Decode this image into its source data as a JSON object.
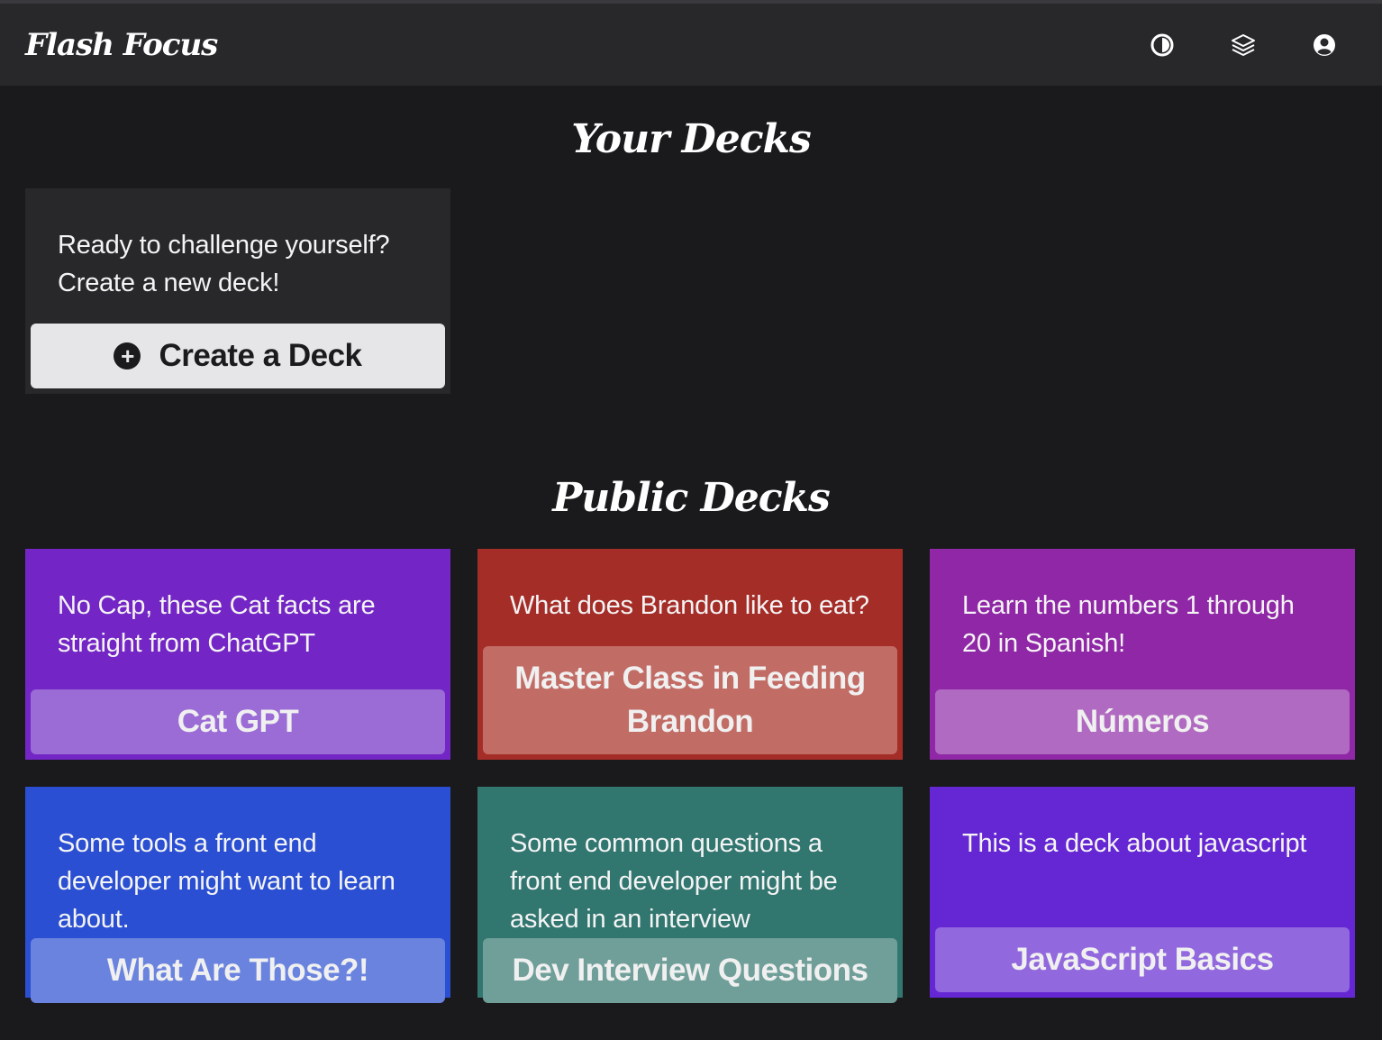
{
  "header": {
    "brand": "Flash Focus",
    "icons": [
      "theme-toggle-icon",
      "decks-stack-icon",
      "account-icon"
    ]
  },
  "your_decks": {
    "title": "Your Decks",
    "create_card": {
      "description": "Ready to challenge yourself? Create a new deck!",
      "button_label": "Create a Deck",
      "button_icon": "plus-circle-icon"
    }
  },
  "public_decks": {
    "title": "Public Decks",
    "decks": [
      {
        "description": "No Cap, these Cat facts are straight from ChatGPT",
        "title": "Cat GPT",
        "color": "#7325c5",
        "button_color": "#9b6bd6"
      },
      {
        "description": "What does Brandon like to eat?",
        "title": "Master Class in Feeding Brandon",
        "color": "#a52d28",
        "button_color": "#c26c66"
      },
      {
        "description": "Learn the numbers 1 through 20 in Spanish!",
        "title": "Números",
        "color": "#8f27a6",
        "button_color": "#b16ac1"
      },
      {
        "description": "Some tools a front end developer might want to learn about.",
        "title": "What Are Those?!",
        "color": "#2a4fd2",
        "button_color": "#6a83df"
      },
      {
        "description": "Some common questions a front end developer might be asked in an interview",
        "title": "Dev Interview Questions",
        "color": "#327670",
        "button_color": "#709f9a"
      },
      {
        "description": "This is a deck about javascript",
        "title": "JavaScript Basics",
        "color": "#6527d3",
        "button_color": "#9268de"
      }
    ]
  }
}
